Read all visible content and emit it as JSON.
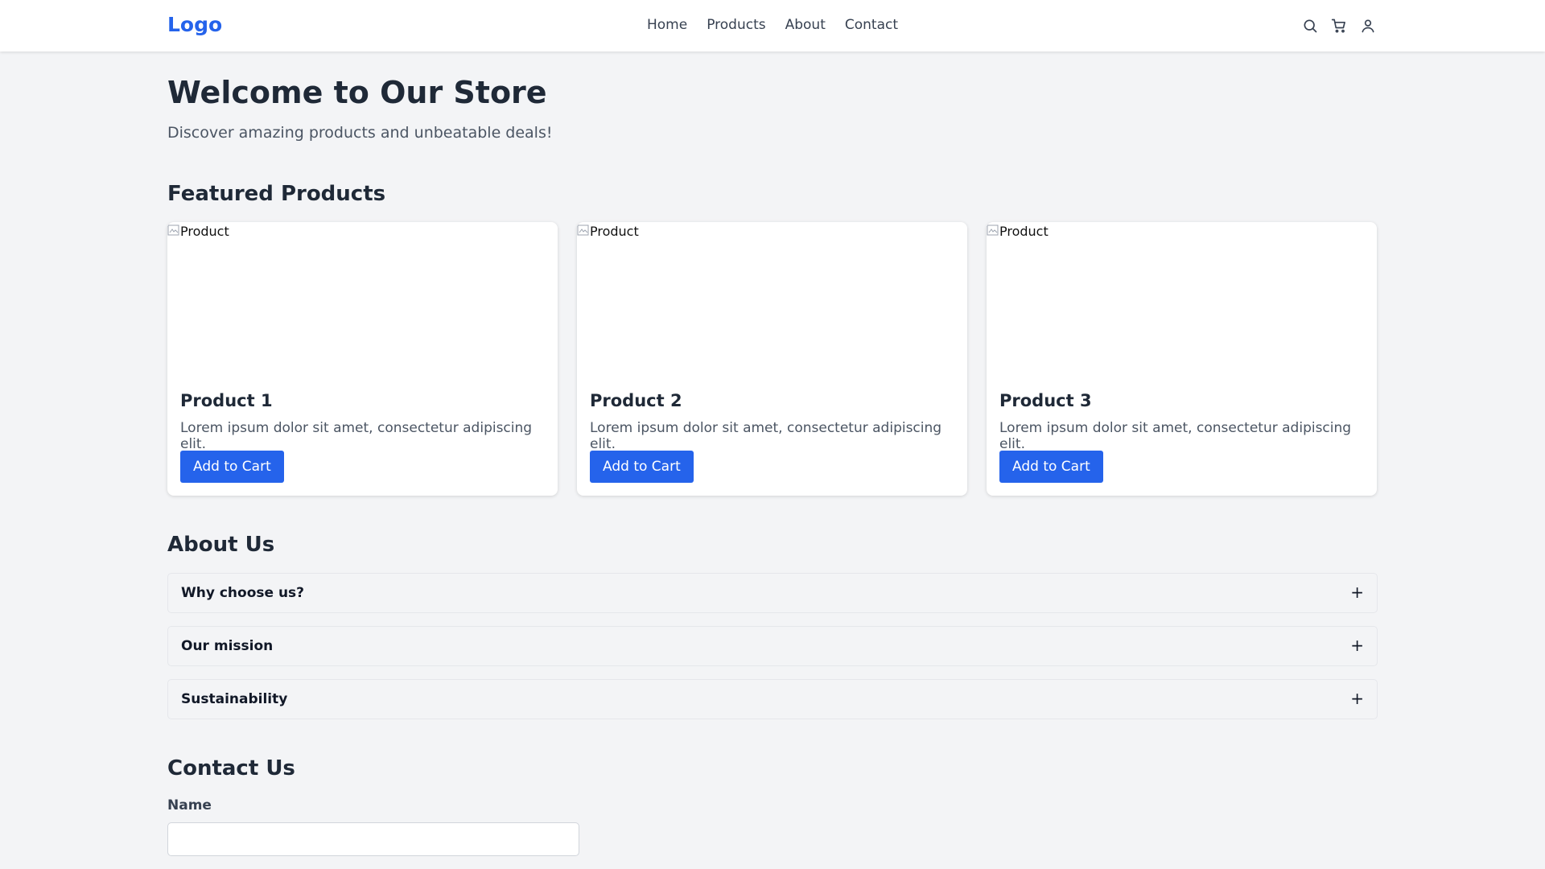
{
  "header": {
    "logo": "Logo",
    "nav": [
      "Home",
      "Products",
      "About",
      "Contact"
    ],
    "icons": [
      "search-icon",
      "cart-icon",
      "user-icon"
    ]
  },
  "hero": {
    "title": "Welcome to Our Store",
    "subtitle": "Discover amazing products and unbeatable deals!"
  },
  "featured": {
    "title": "Featured Products",
    "products": [
      {
        "image_alt": "Product",
        "name": "Product 1",
        "description": "Lorem ipsum dolor sit amet, consectetur adipiscing elit.",
        "button": "Add to Cart"
      },
      {
        "image_alt": "Product",
        "name": "Product 2",
        "description": "Lorem ipsum dolor sit amet, consectetur adipiscing elit.",
        "button": "Add to Cart"
      },
      {
        "image_alt": "Product",
        "name": "Product 3",
        "description": "Lorem ipsum dolor sit amet, consectetur adipiscing elit.",
        "button": "Add to Cart"
      }
    ]
  },
  "about": {
    "title": "About Us",
    "items": [
      {
        "label": "Why choose us?",
        "toggle": "+"
      },
      {
        "label": "Our mission",
        "toggle": "+"
      },
      {
        "label": "Sustainability",
        "toggle": "+"
      }
    ]
  },
  "contact": {
    "title": "Contact Us",
    "name_label": "Name",
    "name_value": ""
  },
  "colors": {
    "accent": "#2563eb",
    "background": "#f3f4f6",
    "text": "#1f2937"
  }
}
